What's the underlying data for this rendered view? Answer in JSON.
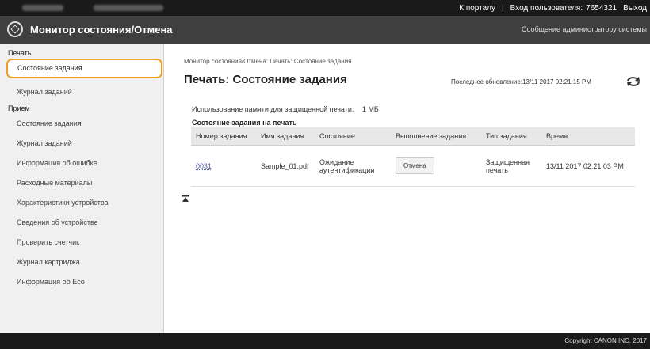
{
  "topbar": {
    "portal_link": "К порталу",
    "user_label": "Вход пользователя:",
    "user_id": "7654321",
    "logout": "Выход"
  },
  "header": {
    "title": "Монитор состояния/Отмена",
    "admin_link": "Сообщение администратору системы"
  },
  "sidebar": {
    "section_print": "Печать",
    "print_items": [
      "Состояние задания",
      "Журнал заданий"
    ],
    "section_receive": "Прием",
    "receive_items": [
      "Состояние задания",
      "Журнал заданий",
      "Информация об ошибке",
      "Расходные материалы",
      "Характеристики устройства",
      "Сведения об устройстве",
      "Проверить счетчик",
      "Журнал картриджа",
      "Информация об Eco"
    ]
  },
  "main": {
    "breadcrumb": "Монитор состояния/Отмена: Печать: Состояние задания",
    "title": "Печать: Состояние задания",
    "last_updated": "Последнее обновление:13/11 2017 02:21:15 PM",
    "memory_label": "Использование памяти для защищенной печати:",
    "memory_value": "1 МБ",
    "table_caption": "Состояние задания на печать",
    "columns": [
      "Номер задания",
      "Имя задания",
      "Состояние",
      "Выполнение задания",
      "Тип задания",
      "Время"
    ],
    "rows": [
      {
        "job_number": "0031",
        "job_name": "Sample_01.pdf",
        "status": "Ожидание аутентификации",
        "action": "Отмена",
        "job_type": "Защищенная печать",
        "time": "13/11 2017 02:21:03 PM"
      }
    ]
  },
  "footer": {
    "copyright": "Copyright CANON INC. 2017"
  },
  "colors": {
    "highlight": "#f0a020",
    "header_bg": "#3f3f3f",
    "topbar_bg": "#1a1a1a",
    "sidebar_bg": "#f0f0f0"
  }
}
